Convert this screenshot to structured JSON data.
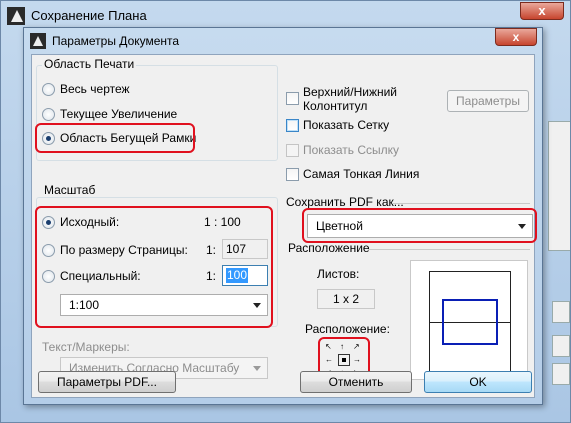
{
  "outer_window": {
    "title": "Сохранение Плана",
    "close": "x"
  },
  "dialog": {
    "title": "Параметры Документа",
    "close": "x",
    "print_area": {
      "label": "Область Печати",
      "options": [
        "Весь чертеж",
        "Текущее Увеличение",
        "Область Бегущей Рамки"
      ],
      "selected": "Область Бегущей Рамки"
    },
    "scale": {
      "label": "Масштаб",
      "original": {
        "label": "Исходный:",
        "value": "1 : 100"
      },
      "fit_page": {
        "label": "По размеру Страницы:",
        "prefix": "1:",
        "value": "107"
      },
      "custom": {
        "label": "Специальный:",
        "prefix": "1:",
        "value": "100"
      },
      "dropdown": "1:100",
      "selected": "Исходный:"
    },
    "text_markers": {
      "label": "Текст/Маркеры:",
      "dropdown": "Изменить Согласно Масштабу"
    },
    "right": {
      "header_footer": "Верхний/Нижний Колонтитул",
      "header_footer_lines": [
        "Верхний/Нижний",
        "Колонтитул"
      ],
      "params_button": "Параметры",
      "show_grid": "Показать Сетку",
      "show_ref": "Показать Ссылку",
      "thinnest_line": "Самая Тонкая Линия",
      "save_pdf_as": "Сохранить PDF как...",
      "pdf_mode": "Цветной",
      "layout_label": "Расположение",
      "sheets_label": "Листов:",
      "sheets_value": "1 x 2",
      "placement_label": "Расположение:"
    },
    "buttons": {
      "pdf_params": "Параметры PDF...",
      "cancel": "Отменить",
      "ok": "OK"
    }
  },
  "colors": {
    "highlight": "#e0101e",
    "preview_rect": "#0a1fb5",
    "selection": "#3399ff"
  }
}
